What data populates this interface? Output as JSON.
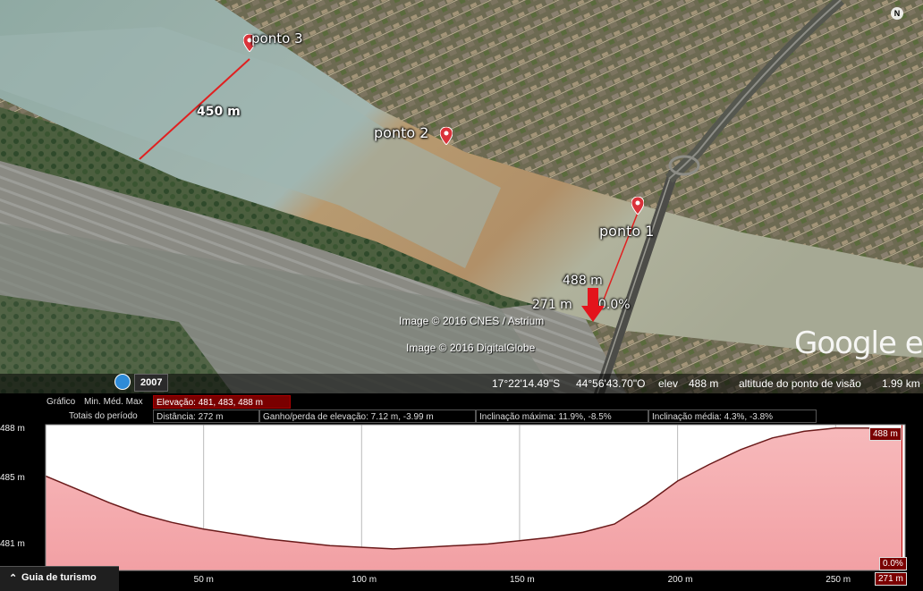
{
  "map": {
    "places": [
      {
        "id": "ponto1",
        "label": "ponto 1"
      },
      {
        "id": "ponto2",
        "label": "ponto 2"
      },
      {
        "id": "ponto3",
        "label": "ponto 3"
      }
    ],
    "measure_label": "450 m",
    "cursor_readout": {
      "elevation": "488 m",
      "distance": "271 m",
      "slope": "0.0%"
    },
    "credits": [
      "Image © 2016 CNES / Astrium",
      "Image © 2016 DigitalGlobe"
    ],
    "logo": "Google ear",
    "compass_label": "N",
    "year": "2007",
    "status": {
      "lat": "17°22'14.49\"S",
      "lon": "44°56'43.70\"O",
      "elev_label": "elev",
      "elev_value": "488 m",
      "eye_label": "altitude do ponto de visão",
      "eye_value": "1.99 km"
    }
  },
  "profile": {
    "row1": {
      "grafico": "Gráfico",
      "minmedmax": "Min. Méd. Max",
      "elevacao": "Elevação: 481, 483, 488 m"
    },
    "row2": {
      "totais": "Totais do período",
      "distancia": "Distância: 272 m",
      "ganho": "Ganho/perda de elevação: 7.12 m, -3.99 m",
      "incl_max": "Inclinação máxima: 11.9%, -8.5%",
      "incl_media": "Inclinação média: 4.3%, -3.8%"
    },
    "cursor_elev_tag": "488 m",
    "cursor_slope_tag": "0.0%",
    "cursor_dist_tag": "271 m",
    "guide_label": "Guia de turismo"
  },
  "chart_data": {
    "type": "area",
    "xlabel": "",
    "ylabel": "",
    "x_unit": "m",
    "y_unit": "m",
    "xlim": [
      0,
      272
    ],
    "ylim": [
      479.5,
      488.3
    ],
    "x_ticks": [
      50,
      100,
      150,
      200,
      250
    ],
    "x_tick_labels": [
      "50 m",
      "100 m",
      "150 m",
      "200 m",
      "250 m"
    ],
    "y_ticks": [
      481,
      485,
      488
    ],
    "y_tick_labels": [
      "481 m",
      "485 m",
      "488 m"
    ],
    "x": [
      0,
      10,
      20,
      30,
      40,
      50,
      60,
      70,
      80,
      90,
      100,
      110,
      120,
      130,
      140,
      150,
      160,
      170,
      180,
      190,
      200,
      210,
      220,
      230,
      240,
      250,
      260,
      271
    ],
    "y": [
      485.2,
      484.4,
      483.6,
      482.9,
      482.4,
      482.0,
      481.7,
      481.4,
      481.2,
      481.0,
      480.9,
      480.8,
      480.9,
      481.0,
      481.1,
      481.3,
      481.5,
      481.8,
      482.3,
      483.5,
      484.9,
      485.9,
      486.8,
      487.5,
      487.9,
      488.1,
      488.1,
      488.0
    ],
    "grid": true,
    "cursor": {
      "x": 271,
      "y": 488,
      "slope": "0.0%"
    }
  }
}
